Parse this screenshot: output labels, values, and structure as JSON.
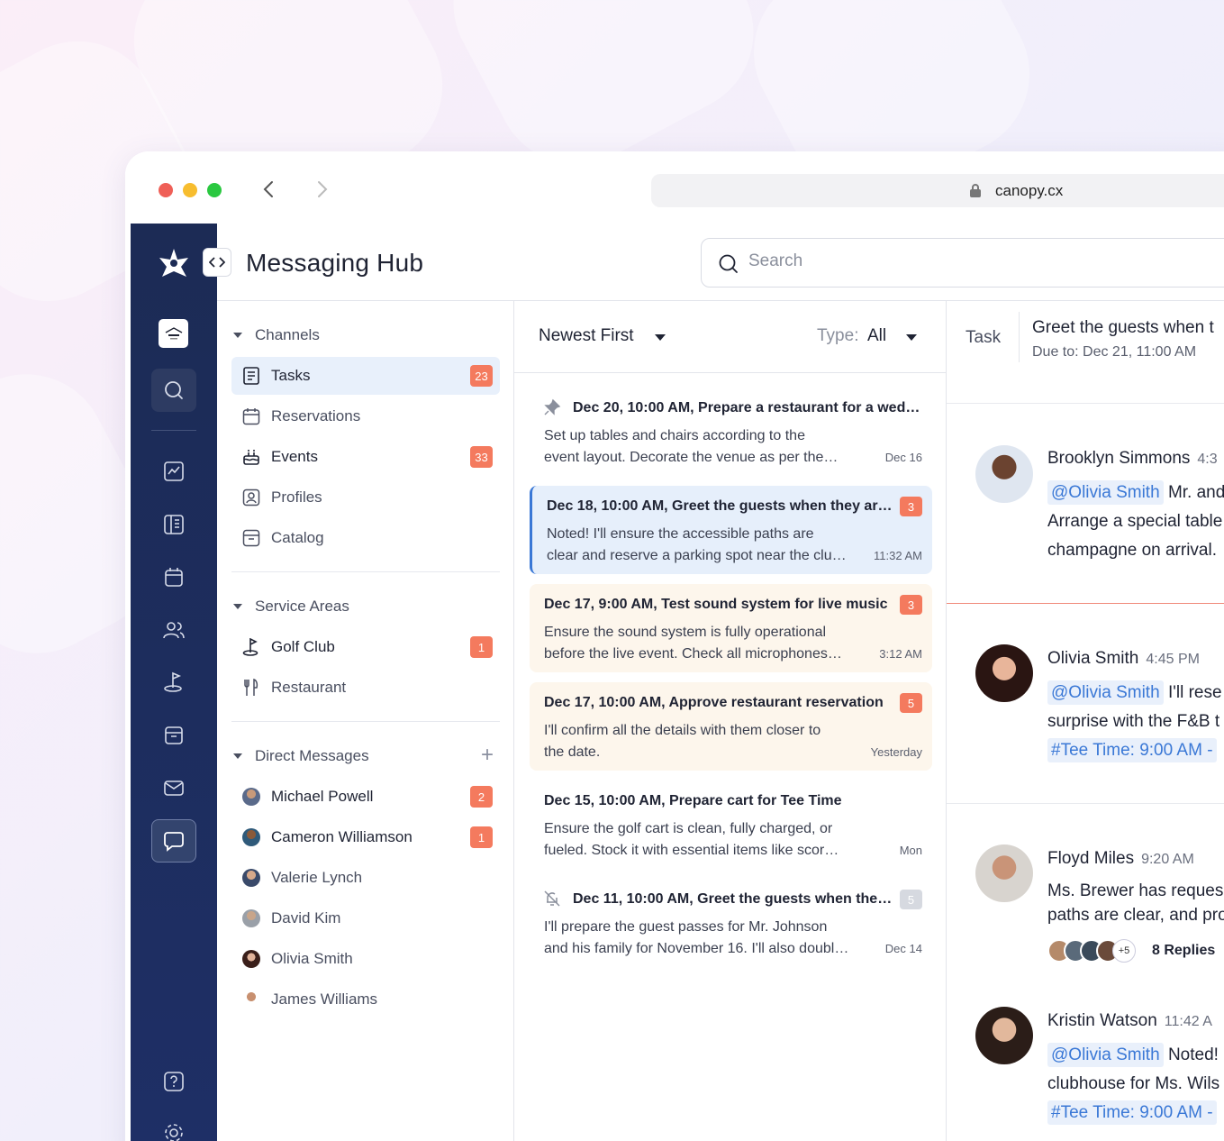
{
  "browser": {
    "url": "canopy.cx",
    "colors": {
      "close": "#ef5f57",
      "minimize": "#f7bd2f",
      "maximize": "#2ac840"
    }
  },
  "header": {
    "title": "Messaging Hub",
    "search_placeholder": "Search"
  },
  "sidebar": {
    "channels_heading": "Channels",
    "channels": [
      {
        "label": "Tasks",
        "icon": "clipboard-icon",
        "badge": "23"
      },
      {
        "label": "Reservations",
        "icon": "calendar-check-icon",
        "badge": ""
      },
      {
        "label": "Events",
        "icon": "cake-icon",
        "badge": "33"
      },
      {
        "label": "Profiles",
        "icon": "profile-icon",
        "badge": ""
      },
      {
        "label": "Catalog",
        "icon": "archive-icon",
        "badge": ""
      }
    ],
    "service_heading": "Service Areas",
    "service_areas": [
      {
        "label": "Golf Club",
        "icon": "golf-icon",
        "badge": "1"
      },
      {
        "label": "Restaurant",
        "icon": "utensils-icon",
        "badge": ""
      }
    ],
    "dm_heading": "Direct Messages",
    "dm_add": "+",
    "direct_messages": [
      {
        "label": "Michael Powell",
        "badge": "2"
      },
      {
        "label": "Cameron Williamson",
        "badge": "1"
      },
      {
        "label": "Valerie Lynch",
        "badge": ""
      },
      {
        "label": "David Kim",
        "badge": ""
      },
      {
        "label": "Olivia Smith",
        "badge": ""
      },
      {
        "label": "James Williams",
        "badge": ""
      }
    ]
  },
  "list": {
    "sort": "Newest First",
    "type_label": "Type:",
    "type_value": "All",
    "tasks": [
      {
        "title": "Dec 20, 10:00 AM, Prepare a restaurant for a wed…",
        "line1": "Set up tables and chairs according to the",
        "line2": "event layout. Decorate the venue as per the…",
        "time": "Dec 16",
        "count": ""
      },
      {
        "title": "Dec 18, 10:00 AM, Greet the guests when they ar…",
        "line1": "Noted! I'll ensure the accessible paths are",
        "line2": "clear and reserve a parking spot near the clu…",
        "time": "11:32 AM",
        "count": "3"
      },
      {
        "title": "Dec 17, 9:00 AM, Test sound system for live music",
        "line1": "Ensure the sound system is fully operational",
        "line2": "before the live event. Check all microphones…",
        "time": "3:12 AM",
        "count": "3"
      },
      {
        "title": "Dec 17, 10:00 AM, Approve restaurant reservation",
        "line1": "I'll confirm all the details with them closer to",
        "line2": "the date.",
        "time": "Yesterday",
        "count": "5"
      },
      {
        "title": "Dec 15, 10:00 AM, Prepare cart for Tee Time",
        "line1": "Ensure the golf cart is clean, fully charged, or",
        "line2": "fueled. Stock it with essential items like scor…",
        "time": "Mon",
        "count": ""
      },
      {
        "title": "Dec 11, 10:00 AM, Greet the guests when the…",
        "line1": "I'll prepare the guest passes for Mr. Johnson",
        "line2": "and his family for November 16. I'll also doubl…",
        "time": "Dec 14",
        "count": "5"
      }
    ]
  },
  "detail": {
    "tag": "Task",
    "title": "Greet the guests when t",
    "due": "Due to: Dec 21, 11:00 AM",
    "messages": [
      {
        "name": "Brooklyn Simmons",
        "time": "4:3",
        "mention": "@Olivia Smith",
        "after_mention": "Mr. and",
        "line2": "Arrange a special table",
        "line3": "champagne on arrival."
      },
      {
        "name": "Olivia Smith",
        "time": "4:45 PM",
        "mention": "@Olivia Smith",
        "after_mention": "I'll rese",
        "line2": "surprise with the F&B t",
        "hashtag": "#Tee Time: 9:00 AM -"
      },
      {
        "name": "Floyd Miles",
        "time": "9:20 AM",
        "line1": "Ms. Brewer has reques",
        "line2": "paths are clear, and pro",
        "replies_more": "+5",
        "replies": "8 Replies"
      },
      {
        "name": "Kristin Watson",
        "time": "11:42 A",
        "mention": "@Olivia Smith",
        "after_mention": "Noted!",
        "line2": "clubhouse for Ms. Wils",
        "hashtag": "#Tee Time: 9:00 AM -"
      }
    ]
  }
}
